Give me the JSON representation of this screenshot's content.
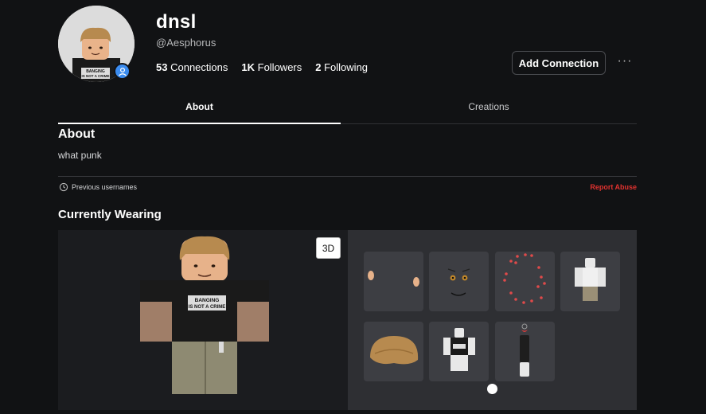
{
  "profile": {
    "display_name": "dnsl",
    "username": "@Aesphorus",
    "connections_count": "53",
    "connections_label": "Connections",
    "followers_count": "1K",
    "followers_label": "Followers",
    "following_count": "2",
    "following_label": "Following",
    "shirt_text_line1": "BANGING",
    "shirt_text_line2": "IS NOT A CRIME"
  },
  "actions": {
    "add_connection": "Add Connection",
    "more": "···"
  },
  "tabs": [
    {
      "label": "About",
      "active": true
    },
    {
      "label": "Creations",
      "active": false
    }
  ],
  "about": {
    "title": "About",
    "description": "what punk",
    "previous_usernames": "Previous usernames",
    "report_abuse": "Report Abuse"
  },
  "wearing": {
    "title": "Currently Wearing",
    "view_toggle": "3D",
    "items": [
      {
        "name": "ears-item-icon"
      },
      {
        "name": "face-item-icon"
      },
      {
        "name": "hearts-accessory-item-icon"
      },
      {
        "name": "white-outfit-item-icon"
      },
      {
        "name": "bowl-hair-item-icon"
      },
      {
        "name": "shirt-item-icon"
      },
      {
        "name": "pendant-item-icon"
      }
    ]
  },
  "colors": {
    "background": "#111214",
    "accent": "#3b8cf0",
    "report": "#e0322f"
  }
}
